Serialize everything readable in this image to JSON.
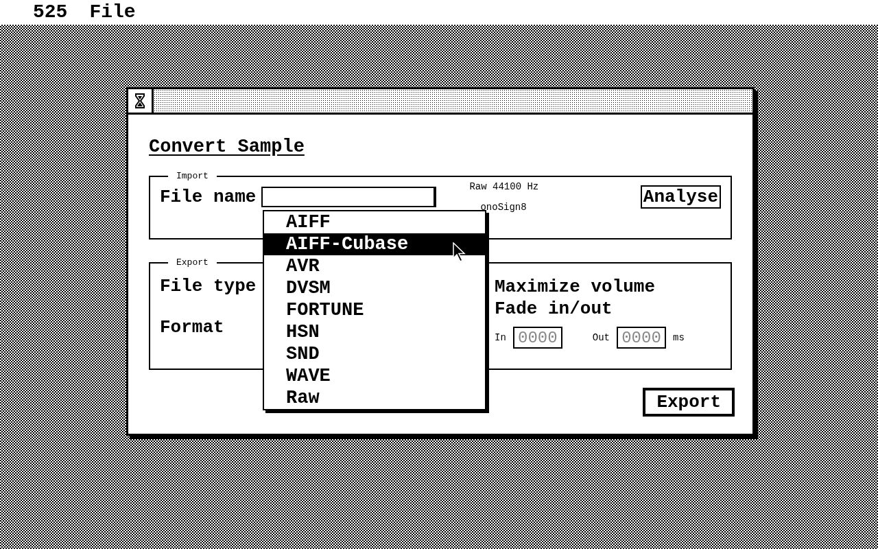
{
  "menu_bar": {
    "items": [
      "525",
      "File"
    ]
  },
  "dialog": {
    "title": "Convert Sample",
    "import": {
      "legend": "Import",
      "file_name_label": "File name",
      "info": [
        "Raw 44100 Hz",
        "onoSign8"
      ],
      "analyse_button": "Analyse"
    },
    "export": {
      "legend": "Export",
      "file_type_label": "File type",
      "format_label": "Format",
      "options": [
        "Maximize volume",
        "Fade in/out"
      ],
      "fade_in": {
        "label": "In",
        "value": "0000",
        "disabled": true
      },
      "fade_out": {
        "label": "Out",
        "value": "0000",
        "disabled": true
      },
      "unit": "ms"
    },
    "export_button": "Export"
  },
  "popup_menu": {
    "items": [
      {
        "label": "AIFF",
        "selected": false
      },
      {
        "label": "AIFF-Cubase",
        "selected": true
      },
      {
        "label": "AVR",
        "selected": false
      },
      {
        "label": "DVSM",
        "selected": false
      },
      {
        "label": "FORTUNE",
        "selected": false
      },
      {
        "label": "HSN",
        "selected": false
      },
      {
        "label": "SND",
        "selected": false
      },
      {
        "label": "WAVE",
        "selected": false
      },
      {
        "label": "Raw",
        "selected": false
      }
    ]
  }
}
